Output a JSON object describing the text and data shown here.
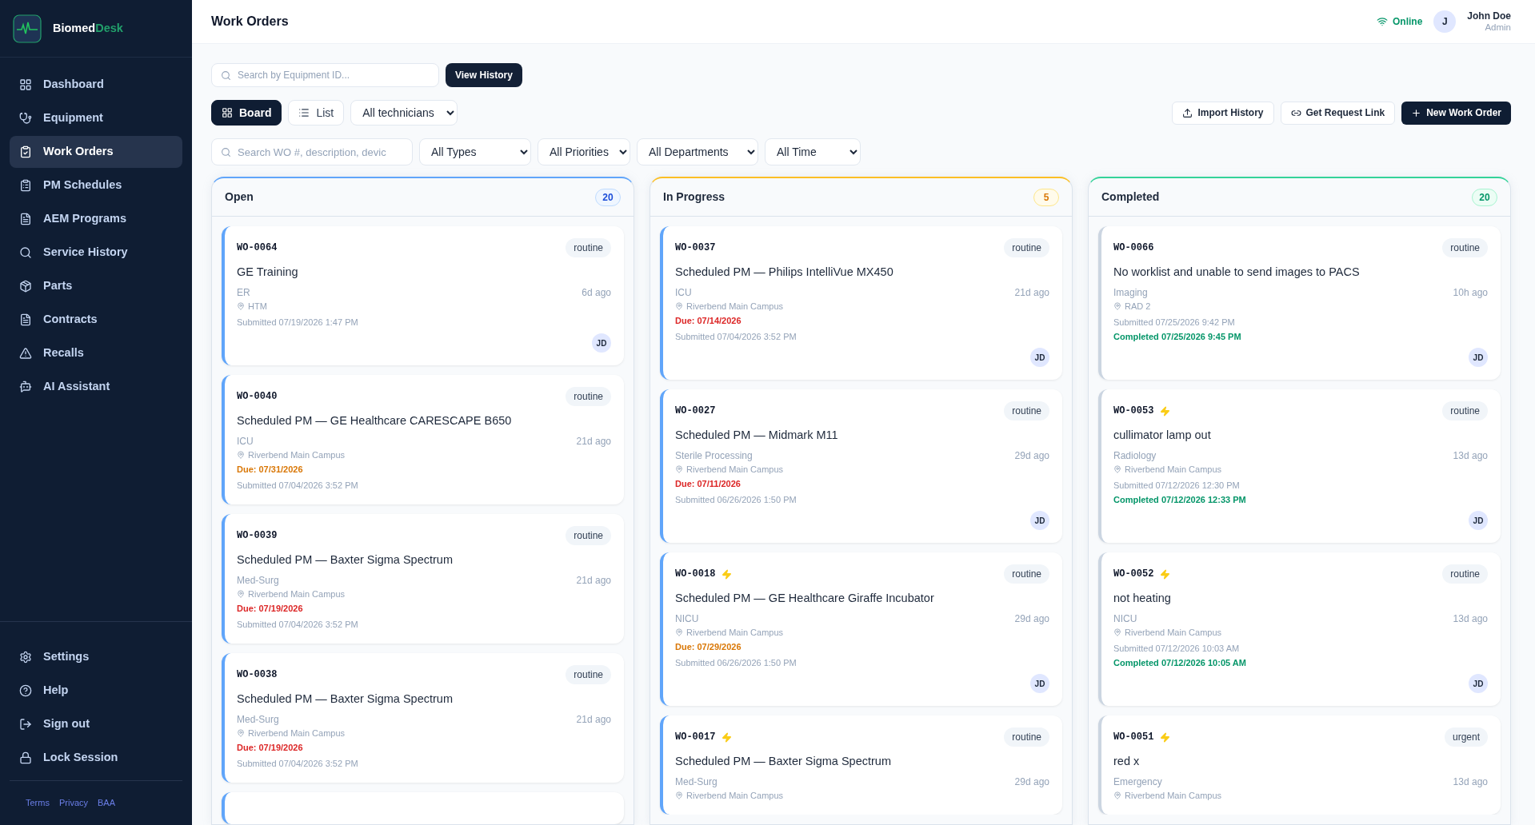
{
  "brand": {
    "name": "Biomed",
    "accent": "Desk"
  },
  "nav": [
    {
      "label": "Dashboard",
      "selected": false
    },
    {
      "label": "Equipment",
      "selected": false
    },
    {
      "label": "Work Orders",
      "selected": true
    },
    {
      "label": "PM Schedules",
      "selected": false
    },
    {
      "label": "AEM Programs",
      "selected": false
    },
    {
      "label": "Service History",
      "selected": false
    },
    {
      "label": "Parts",
      "selected": false
    },
    {
      "label": "Contracts",
      "selected": false
    },
    {
      "label": "Recalls",
      "selected": false
    },
    {
      "label": "AI Assistant",
      "selected": false
    }
  ],
  "nav_bottom": [
    "Settings",
    "Help",
    "Sign out",
    "Lock Session"
  ],
  "footer_links": [
    "Terms",
    "Privacy",
    "BAA"
  ],
  "page_title": "Work Orders",
  "status": "Online",
  "user": {
    "initial": "J",
    "name": "John Doe",
    "role": "Admin"
  },
  "equipment_search": {
    "placeholder": "Search by Equipment ID..."
  },
  "view_history": "View History",
  "view_toggle": [
    {
      "label": "Board",
      "selected": true
    },
    {
      "label": "List",
      "selected": false
    }
  ],
  "technician_filter": "All technicians",
  "actions": [
    {
      "label": "Import History",
      "kind": "secondary"
    },
    {
      "label": "Get Request Link",
      "kind": "secondary"
    },
    {
      "label": "New Work Order",
      "kind": "primary"
    }
  ],
  "search": {
    "placeholder": "Search WO #, description, devic"
  },
  "filters": [
    "All Types",
    "All Priorities",
    "All Departments",
    "All Time"
  ],
  "columns": [
    {
      "title": "Open",
      "count": "20",
      "kind": "open",
      "cards": [
        {
          "id": "WO-0064",
          "urgent": false,
          "priority": "routine",
          "title": "GE Training",
          "department": "ER",
          "age": "6d ago",
          "location": "HTM",
          "submitted": "Submitted 07/19/2026 1:47 PM",
          "assignee": "JD"
        },
        {
          "id": "WO-0040",
          "urgent": false,
          "priority": "routine",
          "title": "Scheduled PM — GE Healthcare CARESCAPE B650",
          "department": "ICU",
          "age": "21d ago",
          "location": "Riverbend Main Campus",
          "due": {
            "text": "Due: 07/31/2026",
            "kind": "soon"
          },
          "submitted": "Submitted 07/04/2026 3:52 PM"
        },
        {
          "id": "WO-0039",
          "urgent": false,
          "priority": "routine",
          "title": "Scheduled PM — Baxter Sigma Spectrum",
          "department": "Med-Surg",
          "age": "21d ago",
          "location": "Riverbend Main Campus",
          "due": {
            "text": "Due: 07/19/2026",
            "kind": "overdue"
          },
          "submitted": "Submitted 07/04/2026 3:52 PM"
        },
        {
          "id": "WO-0038",
          "urgent": false,
          "priority": "routine",
          "title": "Scheduled PM — Baxter Sigma Spectrum",
          "department": "Med-Surg",
          "age": "21d ago",
          "location": "Riverbend Main Campus",
          "due": {
            "text": "Due: 07/19/2026",
            "kind": "overdue"
          },
          "submitted": "Submitted 07/04/2026 3:52 PM"
        },
        {
          "kind": "stub"
        }
      ]
    },
    {
      "title": "In Progress",
      "count": "5",
      "kind": "in_progress",
      "cards": [
        {
          "id": "WO-0037",
          "urgent": false,
          "priority": "routine",
          "title": "Scheduled PM — Philips IntelliVue MX450",
          "department": "ICU",
          "age": "21d ago",
          "location": "Riverbend Main Campus",
          "due": {
            "text": "Due: 07/14/2026",
            "kind": "overdue"
          },
          "submitted": "Submitted 07/04/2026 3:52 PM",
          "assignee": "JD"
        },
        {
          "id": "WO-0027",
          "urgent": false,
          "priority": "routine",
          "title": "Scheduled PM — Midmark M11",
          "department": "Sterile Processing",
          "age": "29d ago",
          "location": "Riverbend Main Campus",
          "due": {
            "text": "Due: 07/11/2026",
            "kind": "overdue"
          },
          "submitted": "Submitted 06/26/2026 1:50 PM",
          "assignee": "JD"
        },
        {
          "id": "WO-0018",
          "urgent": true,
          "priority": "routine",
          "title": "Scheduled PM — GE Healthcare Giraffe Incubator",
          "department": "NICU",
          "age": "29d ago",
          "location": "Riverbend Main Campus",
          "due": {
            "text": "Due: 07/29/2026",
            "kind": "soon"
          },
          "submitted": "Submitted 06/26/2026 1:50 PM",
          "assignee": "JD"
        },
        {
          "id": "WO-0017",
          "urgent": true,
          "priority": "routine",
          "title": "Scheduled PM — Baxter Sigma Spectrum",
          "department": "Med-Surg",
          "age": "29d ago",
          "location": "Riverbend Main Campus"
        }
      ]
    },
    {
      "title": "Completed",
      "count": "20",
      "kind": "completed",
      "cards": [
        {
          "id": "WO-0066",
          "urgent": false,
          "priority": "routine",
          "title": "No worklist and unable to send images to PACS",
          "department": "Imaging",
          "age": "10h ago",
          "location": "RAD 2",
          "submitted": "Submitted 07/25/2026 9:42 PM",
          "completed": "Completed 07/25/2026 9:45 PM",
          "assignee": "JD"
        },
        {
          "id": "WO-0053",
          "urgent": true,
          "priority": "routine",
          "title": "cullimator lamp out",
          "department": "Radiology",
          "age": "13d ago",
          "location": "Riverbend Main Campus",
          "submitted": "Submitted 07/12/2026 12:30 PM",
          "completed": "Completed 07/12/2026 12:33 PM",
          "assignee": "JD"
        },
        {
          "id": "WO-0052",
          "urgent": true,
          "priority": "routine",
          "title": "not heating",
          "department": "NICU",
          "age": "13d ago",
          "location": "Riverbend Main Campus",
          "submitted": "Submitted 07/12/2026 10:03 AM",
          "completed": "Completed 07/12/2026 10:05 AM",
          "assignee": "JD"
        },
        {
          "id": "WO-0051",
          "urgent": true,
          "priority": "urgent",
          "title": "red x",
          "department": "Emergency",
          "age": "13d ago",
          "location": "Riverbend Main Campus"
        }
      ]
    }
  ]
}
